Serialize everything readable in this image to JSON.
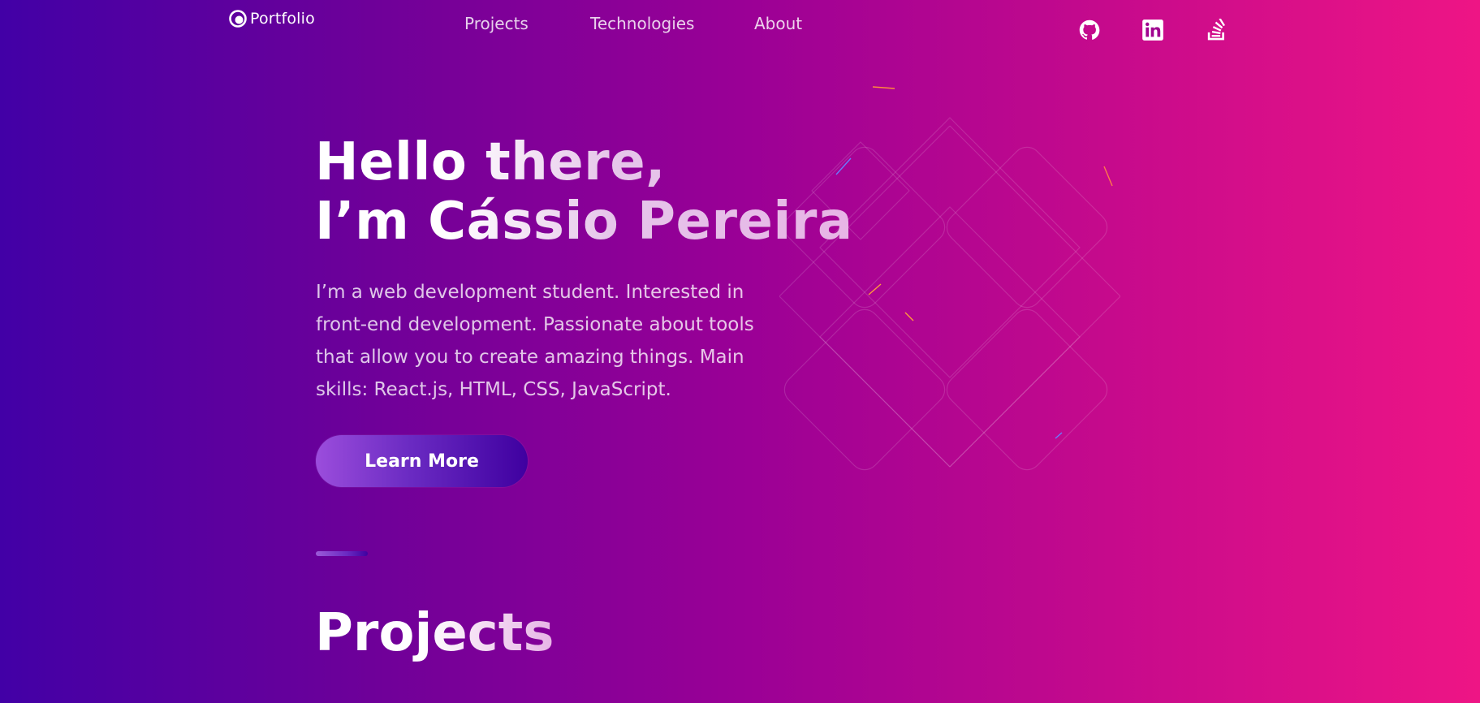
{
  "header": {
    "logo_text": "Portfolio",
    "nav": {
      "projects": "Projects",
      "technologies": "Technologies",
      "about": "About"
    },
    "social_icons": [
      "github-icon",
      "linkedin-icon",
      "stackoverflow-icon"
    ]
  },
  "hero": {
    "title_line1": "Hello there,",
    "title_line2": "I’m Cássio Pereira",
    "description": "I’m a web development student. Interested in front-end development. Passionate about tools that allow you to create amazing things. Main skills: React.js, HTML, CSS, JavaScript.",
    "cta_label": "Learn More"
  },
  "projects": {
    "title": "Projects"
  },
  "colors": {
    "background_start": "#4200a6",
    "background_end": "#ee1585",
    "button_start": "#9b4ddc",
    "button_end": "#3f00a0"
  }
}
